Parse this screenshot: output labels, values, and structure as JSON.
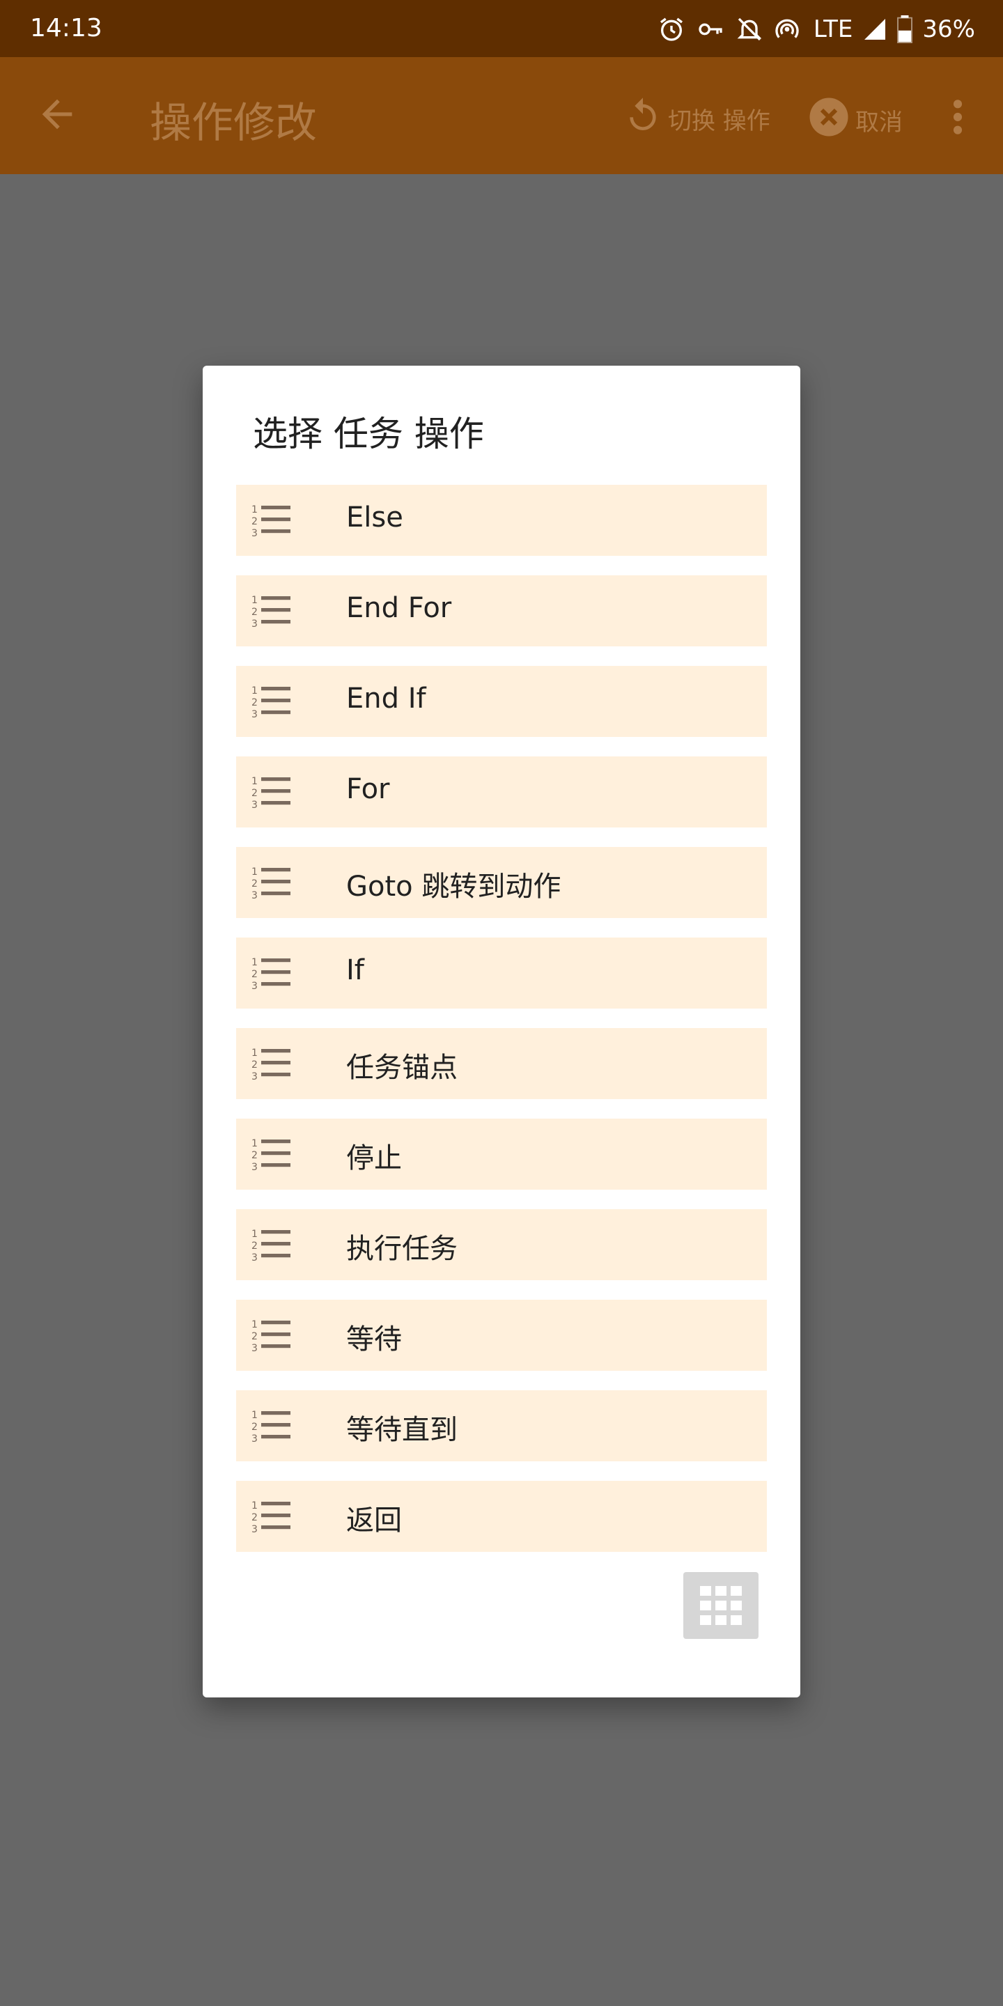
{
  "status_bar": {
    "time": "14:13",
    "network": "LTE",
    "battery": "36%",
    "icons": [
      "alarm-icon",
      "vpn-key-icon",
      "notifications-off-icon",
      "hotspot-icon",
      "signal-icon",
      "battery-icon"
    ]
  },
  "app_bar": {
    "title": "操作修改",
    "switch_label": "切换 操作",
    "cancel_label": "取消"
  },
  "dialog": {
    "title": "选择 任务 操作",
    "items": [
      {
        "label": "Else"
      },
      {
        "label": "End For"
      },
      {
        "label": "End If"
      },
      {
        "label": "For"
      },
      {
        "label": "Goto 跳转到动作"
      },
      {
        "label": "If"
      },
      {
        "label": "任务锚点"
      },
      {
        "label": "停止"
      },
      {
        "label": "执行任务"
      },
      {
        "label": "等待"
      },
      {
        "label": "等待直到"
      },
      {
        "label": "返回"
      }
    ]
  },
  "colors": {
    "status_bar": "#5f2e00",
    "app_bar": "#8a4a0b",
    "scrim": "#676767",
    "item_bg": "#fff0dc"
  }
}
